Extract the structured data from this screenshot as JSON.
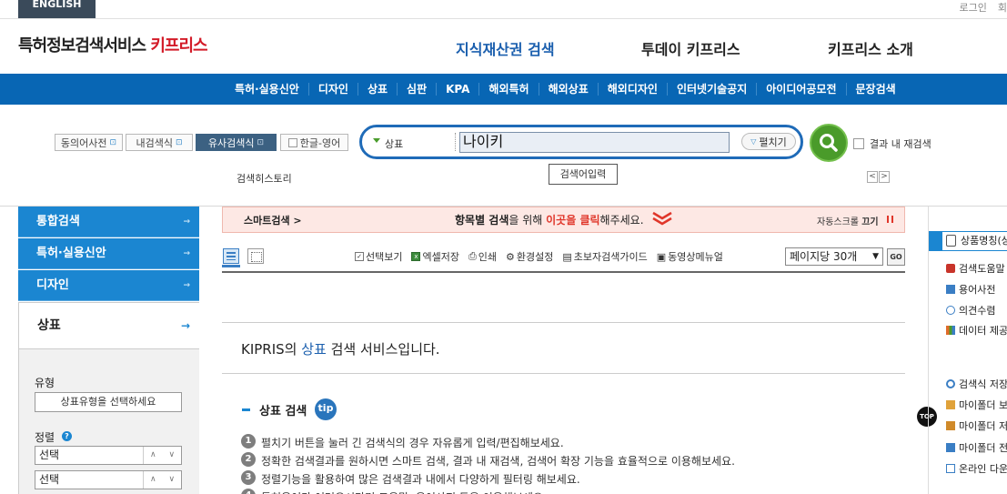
{
  "topbar": {
    "english": "ENGLISH",
    "links": [
      "로그인",
      "회"
    ]
  },
  "header": {
    "logo_main": "특허정보검색서비스",
    "logo_brand": "키프리스",
    "gnb": [
      "지식재산권 검색",
      "투데이 키프리스",
      "키프리스 소개"
    ]
  },
  "menu": [
    "특허·실용신안",
    "디자인",
    "상표",
    "심판",
    "KPA",
    "해외특허",
    "해외상표",
    "해외디자인",
    "인터넷기술공지",
    "아이디어공모전",
    "문장검색"
  ],
  "search": {
    "toggles": [
      "동의어사전",
      "내검색식",
      "유사검색식",
      "한글-영어"
    ],
    "category": "상표",
    "query": "나이키",
    "expand": "펼치기",
    "research": "결과 내 재검색",
    "tooltip": "검색어입력",
    "history": "검색히스토리",
    "pager_prev": "<",
    "pager_next": ">"
  },
  "leftnav": {
    "items": [
      "통합검색",
      "특허·실용신안",
      "디자인"
    ],
    "active": "상표",
    "arrow": "→",
    "type_label": "유형",
    "type_select": "상표유형을 선택하세요",
    "sort_label": "정렬",
    "help": "?",
    "sort1": "선택",
    "sort2": "선택",
    "up": "∧",
    "down": "∨"
  },
  "smart": {
    "label": "스마트검색 >",
    "msg_pre": "항목별 검색",
    "msg_mid": "을 위해 ",
    "msg_link": "이곳을 클릭",
    "msg_post": "해주세요.",
    "auto_pre": "자동스크롤 ",
    "auto_bold": "끄기"
  },
  "toolbar": {
    "tools": [
      "선택보기",
      "엑셀저장",
      "인쇄",
      "환경설정",
      "초보자검색가이드",
      "동영상메뉴얼"
    ],
    "perpage": "페이지당 30개",
    "go": "GO"
  },
  "content": {
    "intro_pre": "KIPRIS의 ",
    "intro_em": "상표",
    "intro_post": " 검색 서비스입니다.",
    "section_title": "상표 검색",
    "tip": "tip",
    "tips": [
      "펼치기 버튼을 눌러 긴 검색식의 경우 자유롭게 입력/편집해보세요.",
      "정확한 검색결과를 원하시면 스마트 검색, 결과 내 재검색, 검색어 확장 기능을 효율적으로 이용해보세요.",
      "정렬기능을 활용하여 많은 검색결과 내에서 다양하게 필터링 해보세요.",
      "특허용어가 어려우시다면 도움말, 용어사전 등을 이용해보세요."
    ]
  },
  "top_button": "TOP",
  "right": {
    "top": "상품명칭(상",
    "links": [
      "검색도움말",
      "용어사전",
      "의견수렴",
      "데이터 제공"
    ],
    "links2": [
      "검색식 저장",
      "마이폴더 보",
      "마이폴더 저",
      "마이폴더 전",
      "온라인 다운"
    ]
  },
  "colors": {
    "brand_red": "#d31b28",
    "menu_blue": "#0866b4",
    "nav_blue": "#1b86d1",
    "search_green": "#4a9b2a"
  }
}
